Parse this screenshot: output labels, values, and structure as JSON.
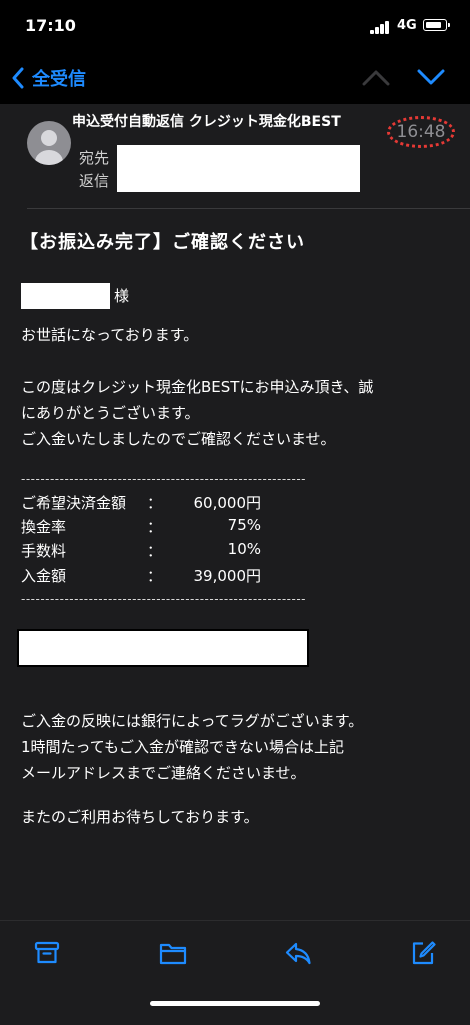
{
  "status": {
    "time": "17:10",
    "network": "4G"
  },
  "nav": {
    "back_label": "全受信"
  },
  "header": {
    "sender": "申込受付自動返信 クレジット現金化BEST",
    "time": "16:48",
    "to_label": "宛先",
    "reply_label": "返信"
  },
  "email": {
    "subject": "【お振込み完了】ご確認ください",
    "honorific": "様",
    "greeting": "お世話になっております。",
    "thanks_lines": [
      "この度はクレジット現金化BESTにお申込み頂き、誠",
      "にありがとうございます。",
      "ご入金いたしましたのでご確認くださいませ。"
    ],
    "separator": "-----------------------------------------------------------",
    "fees": [
      {
        "label": "ご希望決済金額",
        "colon": "：",
        "value": "60,000円"
      },
      {
        "label": "換金率",
        "colon": "：",
        "value": "75%"
      },
      {
        "label": "手数料",
        "colon": "：",
        "value": "10%"
      },
      {
        "label": "入金額",
        "colon": "：",
        "value": "39,000円"
      }
    ],
    "notice_lines": [
      "ご入金の反映には銀行によってラグがございます。",
      "1時間たってもご入金が確認できない場合は上記",
      "メールアドレスまでご連絡くださいませ。"
    ],
    "closing": "またのご利用お待ちしております。"
  },
  "colors": {
    "accent": "#1e8bff",
    "background": "#1c1c1e",
    "highlight": "#e53935"
  },
  "icons": [
    "back-chevron-icon",
    "chevron-up-icon",
    "chevron-down-icon",
    "archive-icon",
    "folder-icon",
    "reply-icon",
    "compose-icon"
  ]
}
